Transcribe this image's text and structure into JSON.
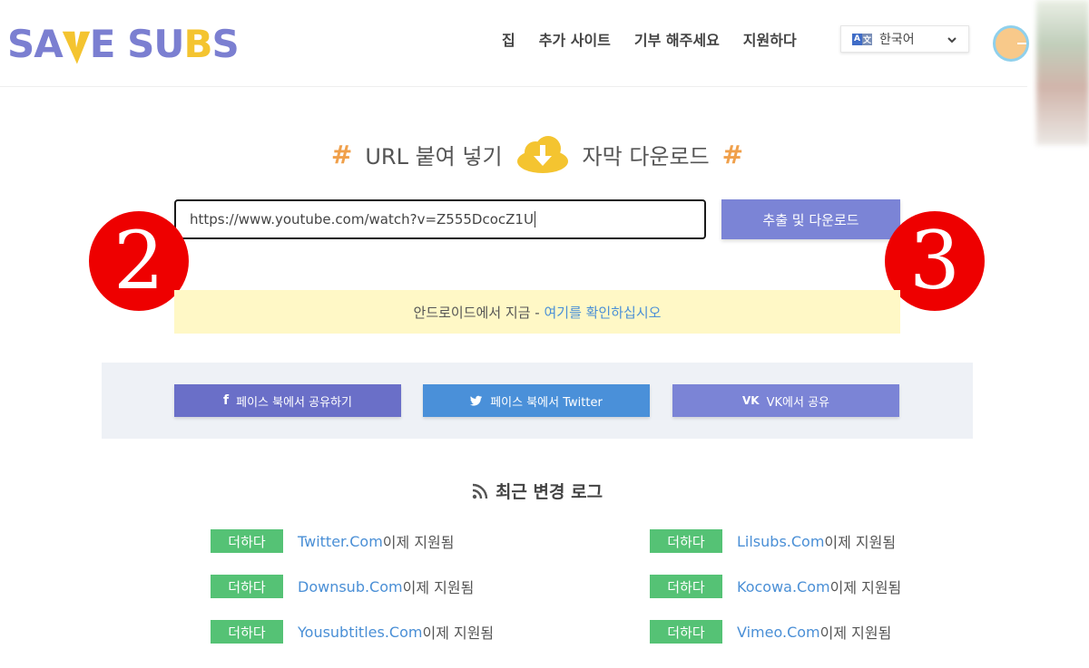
{
  "logo": {
    "part1": "SA",
    "part2": "E ",
    "part3": "SU",
    "part4": "B",
    "part5": "S"
  },
  "nav": {
    "home": "집",
    "more_sites": "추가 사이트",
    "donate": "기부 해주세요",
    "support": "지원하다"
  },
  "language": {
    "selected": "한국어"
  },
  "hero": {
    "left": "URL 붙여 넣기",
    "right": "자막 다운로드",
    "hash": "#"
  },
  "url_input": {
    "value": "https://www.youtube.com/watch?v=Z555DcocZ1U"
  },
  "extract_button": "추출 및 다운로드",
  "badges": {
    "left": "2",
    "right": "3"
  },
  "notice": {
    "text": "안드로이드에서 지금 - ",
    "link": "여기를 확인하십시오"
  },
  "share": {
    "facebook": "페이스 북에서 공유하기",
    "twitter": "페이스 북에서 Twitter",
    "vk": "VK에서 공유"
  },
  "changelog": {
    "title": "최근 변경 로그",
    "items": [
      {
        "tag": "더하다",
        "site": "Twitter.Com",
        "suffix": " 이제 지원됨"
      },
      {
        "tag": "더하다",
        "site": "Lilsubs.Com",
        "suffix": " 이제 지원됨"
      },
      {
        "tag": "더하다",
        "site": "Downsub.Com",
        "suffix": " 이제 지원됨"
      },
      {
        "tag": "더하다",
        "site": "Kocowa.Com",
        "suffix": " 이제 지원됨"
      },
      {
        "tag": "더하다",
        "site": "Yousubtitles.Com",
        "suffix": " 이제 지원됨"
      },
      {
        "tag": "더하다",
        "site": "Vimeo.Com",
        "suffix": " 이제 지원됨"
      }
    ]
  },
  "colors": {
    "accent": "#7b84d6",
    "tag_green": "#55c275",
    "hash_orange": "#f0a04b",
    "badge_red": "#ee0000"
  }
}
